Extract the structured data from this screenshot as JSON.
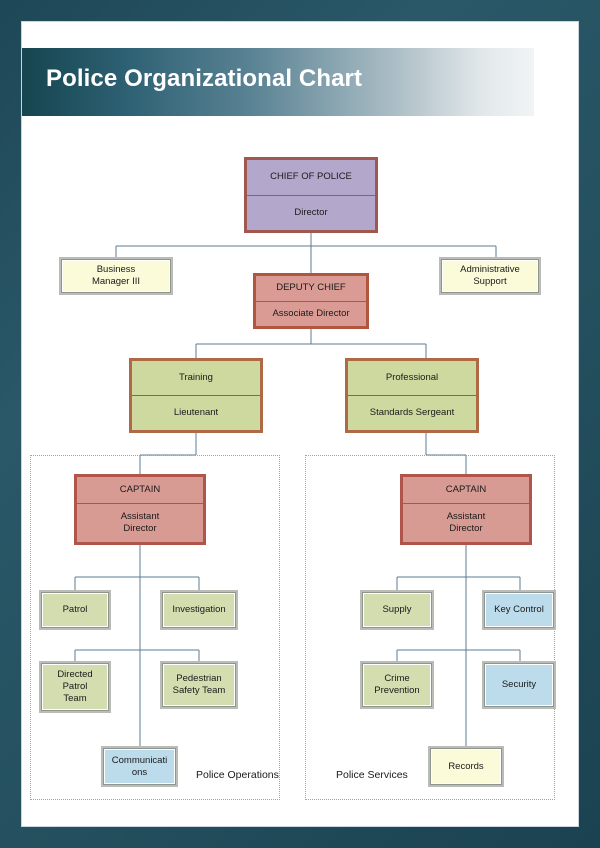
{
  "banner": {
    "title": "Police Organizational Chart"
  },
  "chart_data": {
    "type": "diagram",
    "title": "Police Organizational Chart",
    "nodes": [
      {
        "id": "chief",
        "title": "CHIEF OF POLICE",
        "role": "Director",
        "style": "purple"
      },
      {
        "id": "business",
        "title": "Business\nManager III",
        "role": "",
        "style": "cream"
      },
      {
        "id": "deputy",
        "title": "DEPUTY CHIEF",
        "role": "Associate Director",
        "style": "salmon"
      },
      {
        "id": "admin",
        "title": "Administrative\nSupport",
        "role": "",
        "style": "cream"
      },
      {
        "id": "training",
        "title": "Training",
        "role": "Lieutenant",
        "style": "greenframed"
      },
      {
        "id": "prostd",
        "title": "Professional",
        "role": "Standards Sergeant",
        "style": "greenframed"
      },
      {
        "id": "captain1",
        "title": "CAPTAIN",
        "role": "Assistant\nDirector",
        "style": "captain"
      },
      {
        "id": "captain2",
        "title": "CAPTAIN",
        "role": "Assistant\nDirector",
        "style": "captain"
      },
      {
        "id": "patrol",
        "title": "Patrol",
        "role": "",
        "style": "green"
      },
      {
        "id": "investigation",
        "title": "Investigation",
        "role": "",
        "style": "green"
      },
      {
        "id": "directed",
        "title": "Directed\nPatrol\nTeam",
        "role": "",
        "style": "green"
      },
      {
        "id": "pedestrian",
        "title": "Pedestrian\nSafety Team",
        "role": "",
        "style": "green"
      },
      {
        "id": "comms",
        "title": "Communicati\nons",
        "role": "",
        "style": "blue"
      },
      {
        "id": "supply",
        "title": "Supply",
        "role": "",
        "style": "green"
      },
      {
        "id": "keycontrol",
        "title": "Key Control",
        "role": "",
        "style": "blue"
      },
      {
        "id": "crime",
        "title": "Crime\nPrevention",
        "role": "",
        "style": "green"
      },
      {
        "id": "security",
        "title": "Security",
        "role": "",
        "style": "blue"
      },
      {
        "id": "records",
        "title": "Records",
        "role": "",
        "style": "cream"
      }
    ],
    "groups": [
      {
        "id": "ops",
        "label": "Police Operations"
      },
      {
        "id": "services",
        "label": "Police Services"
      }
    ],
    "edges": [
      [
        "chief",
        "business"
      ],
      [
        "chief",
        "deputy"
      ],
      [
        "chief",
        "admin"
      ],
      [
        "deputy",
        "training"
      ],
      [
        "deputy",
        "prostd"
      ],
      [
        "training",
        "captain1"
      ],
      [
        "prostd",
        "captain2"
      ],
      [
        "captain1",
        "patrol"
      ],
      [
        "captain1",
        "investigation"
      ],
      [
        "captain1",
        "directed"
      ],
      [
        "captain1",
        "pedestrian"
      ],
      [
        "captain1",
        "comms"
      ],
      [
        "captain2",
        "supply"
      ],
      [
        "captain2",
        "keycontrol"
      ],
      [
        "captain2",
        "crime"
      ],
      [
        "captain2",
        "security"
      ],
      [
        "captain2",
        "records"
      ]
    ],
    "colors": {
      "page_background": "#24505f",
      "sheet": "#ffffff",
      "connector": "#5b7c95",
      "purple_fill": "#b3a7cc",
      "salmon_fill": "#d99b94",
      "green_fill": "#d3ddb0",
      "green_framed_fill": "#cdd99f",
      "blue_fill": "#bcdcec",
      "cream_fill": "#fbfbd9",
      "red_border": "#b0563f",
      "grey_border": "#8f9691",
      "group_border": "#8fa8bb"
    }
  }
}
